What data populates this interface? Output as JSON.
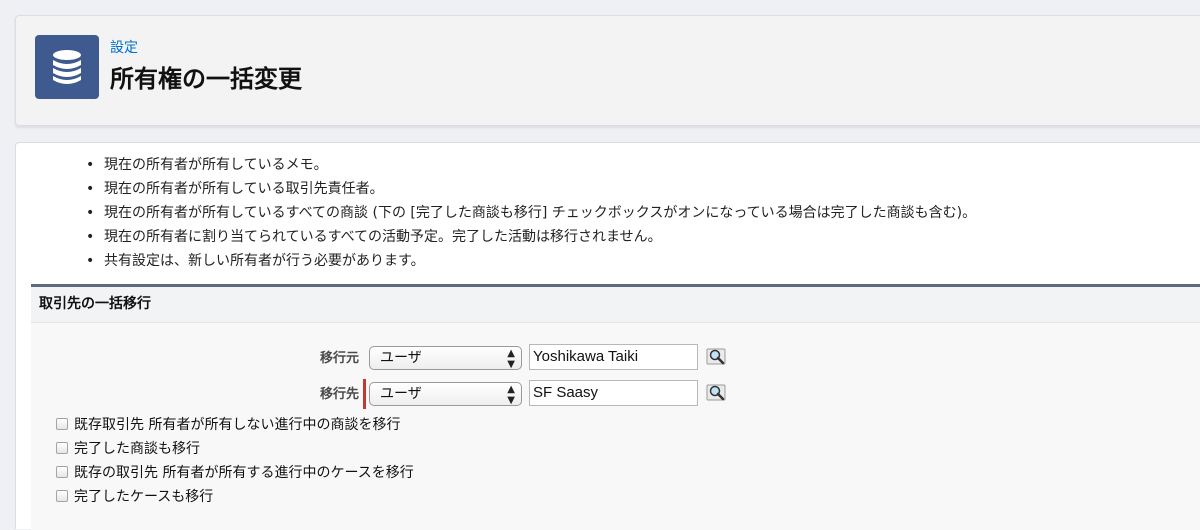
{
  "header": {
    "breadcrumb": "設定",
    "title": "所有権の一括変更",
    "icon": "database-icon",
    "icon_color": "#3e5a8f"
  },
  "bullets": [
    "現在の所有者が所有しているメモ。",
    "現在の所有者が所有している取引先責任者。",
    "現在の所有者が所有しているすべての商談 (下の [完了した商談も移行] チェックボックスがオンになっている場合は完了した商談も含む)。",
    "現在の所有者に割り当てられているすべての活動予定。完了した活動は移行されません。",
    "共有設定は、新しい所有者が行う必要があります。"
  ],
  "section": {
    "title": "取引先の一括移行",
    "from": {
      "label": "移行元",
      "select_value": "ユーザ",
      "input_value": "Yoshikawa Taiki"
    },
    "to": {
      "label": "移行先",
      "select_value": "ユーザ",
      "input_value": "SF Saasy",
      "required_color": "#c23934"
    },
    "checkboxes": [
      {
        "label": "既存取引先 所有者が所有しない進行中の商談を移行",
        "checked": false
      },
      {
        "label": "完了した商談も移行",
        "checked": false
      },
      {
        "label": "既存の取引先 所有者が所有する進行中のケースを移行",
        "checked": false
      },
      {
        "label": "完了したケースも移行",
        "checked": false
      }
    ]
  }
}
